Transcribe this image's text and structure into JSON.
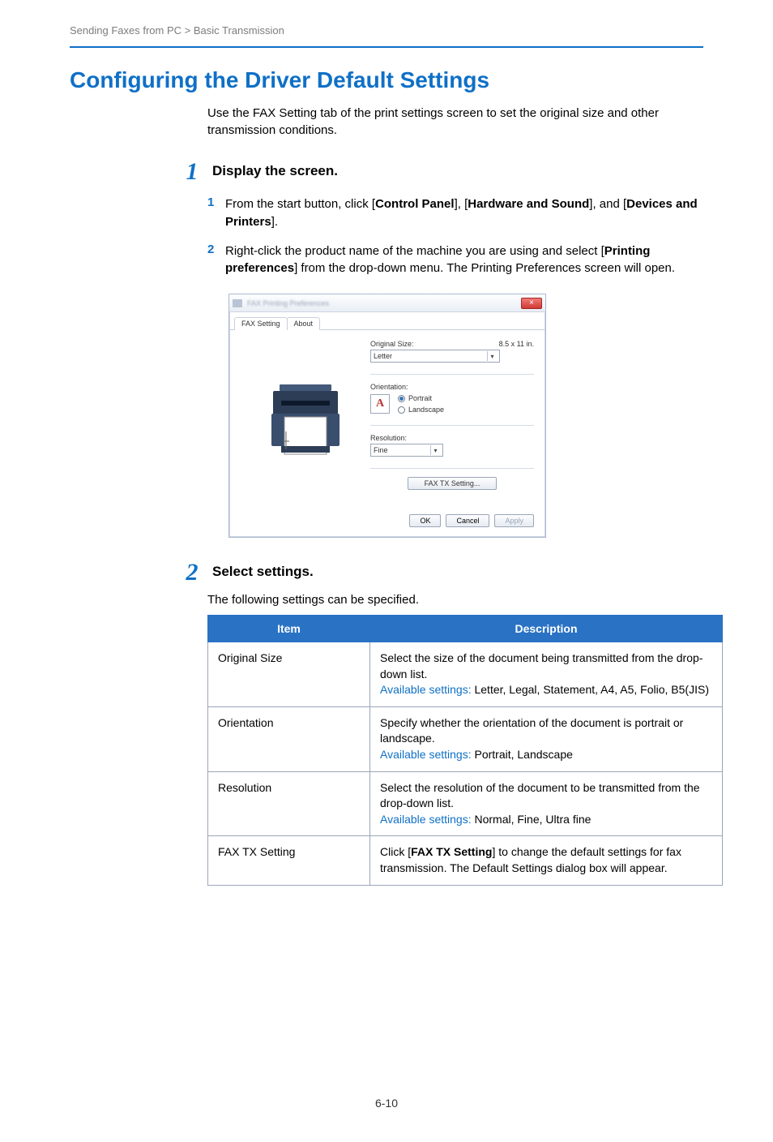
{
  "breadcrumb": "Sending Faxes from PC > Basic Transmission",
  "title": "Configuring the Driver Default Settings",
  "intro": "Use the FAX Setting tab of the print settings screen to set the original size and other transmission conditions.",
  "step1": {
    "num": "1",
    "heading": "Display the screen.",
    "sub1_num": "1",
    "sub1_a": "From the start button, click [",
    "sub1_b": "Control Panel",
    "sub1_c": "], [",
    "sub1_d": "Hardware and Sound",
    "sub1_e": "], and [",
    "sub1_f": "Devices and Printers",
    "sub1_g": "].",
    "sub2_num": "2",
    "sub2_a": "Right-click the product name of the machine you are using and select [",
    "sub2_b": "Printing preferences",
    "sub2_c": "] from the drop-down menu. The Printing Preferences screen will open."
  },
  "dialog": {
    "title_blur": "FAX Printing Preferences",
    "close": "×",
    "tab1": "FAX Setting",
    "tab2": "About",
    "orig_label": "Original Size:",
    "orig_dim": "8.5 x 11 in.",
    "orig_value": "Letter",
    "orient_label": "Orientation:",
    "orient_A": "A",
    "portrait": "Portrait",
    "landscape": "Landscape",
    "res_label": "Resolution:",
    "res_value": "Fine",
    "faxtx_btn": "FAX TX Setting...",
    "ok": "OK",
    "cancel": "Cancel",
    "apply": "Apply"
  },
  "step2": {
    "num": "2",
    "heading": "Select settings.",
    "body": "The following settings can be specified."
  },
  "table": {
    "h_item": "Item",
    "h_desc": "Description",
    "r1_item": "Original Size",
    "r1_desc": "Select the size of the document being transmitted from the drop-down list.",
    "r1_av_label": "Available settings:",
    "r1_av_vals": " Letter, Legal, Statement, A4, A5, Folio, B5(JIS)",
    "r2_item": "Orientation",
    "r2_desc": "Specify whether the orientation of the document is portrait or landscape.",
    "r2_av_label": "Available settings:",
    "r2_av_vals": " Portrait, Landscape",
    "r3_item": "Resolution",
    "r3_desc": "Select the resolution of the document to be transmitted from the drop-down list.",
    "r3_av_label": "Available settings:",
    "r3_av_vals": " Normal, Fine, Ultra fine",
    "r4_item": "FAX TX Setting",
    "r4_desc_a": "Click [",
    "r4_desc_b": "FAX TX Setting",
    "r4_desc_c": "] to change the default settings for fax transmission. The Default Settings dialog box will appear."
  },
  "page_num": "6-10"
}
